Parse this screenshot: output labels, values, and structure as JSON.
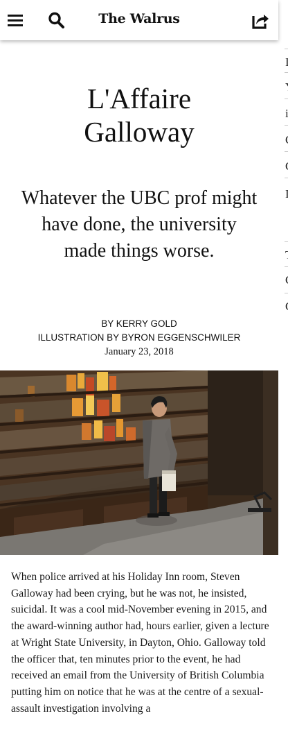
{
  "header": {
    "brand": "The Walrus",
    "icons": [
      "menu-icon",
      "search-icon",
      "share-icon"
    ]
  },
  "article": {
    "headline_line1": "L'Affaire",
    "headline_line2": "Galloway",
    "dek": "Whatever the UBC prof might have done, the university made things worse.",
    "byline": "BY KERRY GOLD",
    "illustration_credit": "ILLUSTRATION BY BYRON EGGENSCHWILER",
    "date": "January 23, 2018",
    "body": "When police arrived at his Holiday Inn room, Steven Galloway had been crying, but he was not, he insisted, suicidal. It was a cool mid-November evening in 2015, and the award-winning author had, hours earlier, given a lecture at Wright State University, in Dayton, Ohio. Galloway told the officer that, ten minutes prior to the event, he had received an email from the University of British Columbia putting him on notice that he was at the centre of a sexual-assault investigation involving a"
  },
  "colors": {
    "background": "#ffffff",
    "text": "#111111",
    "shadow": "rgba(0,0,0,0.28)"
  }
}
